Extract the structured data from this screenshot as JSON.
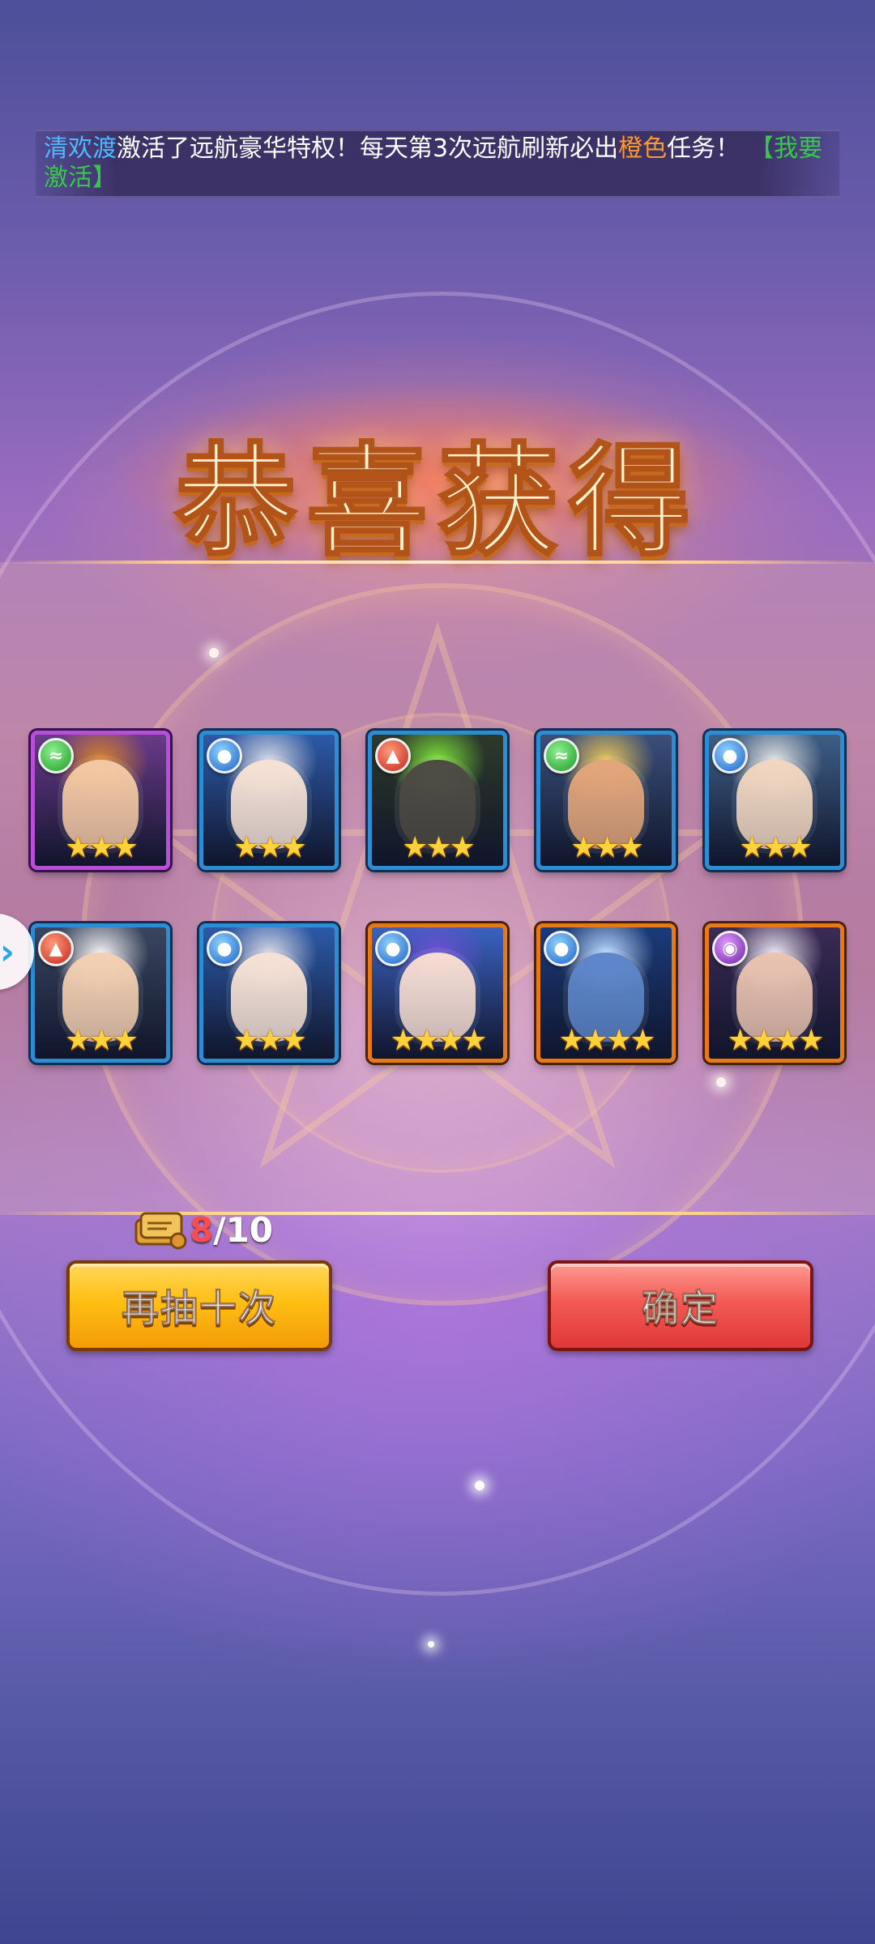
{
  "notice": {
    "player_name": "清欢渡",
    "text_1": "激活了远航豪华特权！每天第3次远航刷新必出",
    "highlight": "橙色",
    "text_2": "任务！",
    "link": "【我要激活】"
  },
  "title": "恭喜获得",
  "heroes": [
    {
      "element": "wind",
      "element_icon": "wind-element-icon",
      "frame": "purple",
      "stars": 3,
      "skin": "#f3c9a3",
      "hair": "#d9842e",
      "bg": "#6a3a8a"
    },
    {
      "element": "water",
      "element_icon": "water-element-icon",
      "frame": "blue",
      "stars": 3,
      "skin": "#f6e1d4",
      "hair": "#d6d8e6",
      "bg": "#2c5aa8"
    },
    {
      "element": "fire",
      "element_icon": "fire-element-icon",
      "frame": "blue",
      "stars": 3,
      "skin": "#4d4a44",
      "hair": "#7fe23a",
      "bg": "#2d3a2a"
    },
    {
      "element": "wind",
      "element_icon": "wind-element-icon",
      "frame": "blue",
      "stars": 3,
      "skin": "#e2a57a",
      "hair": "#e8c45a",
      "bg": "#3a4f7a"
    },
    {
      "element": "water",
      "element_icon": "water-element-icon",
      "frame": "blue",
      "stars": 3,
      "skin": "#f1d6c0",
      "hair": "#e2e2e2",
      "bg": "#3e5e86"
    },
    {
      "element": "fire",
      "element_icon": "fire-element-icon",
      "frame": "blue",
      "stars": 3,
      "skin": "#f3cfb1",
      "hair": "#f2f2f2",
      "bg": "#3a4660"
    },
    {
      "element": "water",
      "element_icon": "water-element-icon",
      "frame": "blue",
      "stars": 3,
      "skin": "#f6e1d4",
      "hair": "#d6d8e6",
      "bg": "#2c5aa8"
    },
    {
      "element": "water",
      "element_icon": "water-element-icon",
      "frame": "orange",
      "stars": 4,
      "skin": "#f6dcd0",
      "hair": "#6c4fd2",
      "bg": "#3a62c0"
    },
    {
      "element": "water",
      "element_icon": "water-element-icon",
      "frame": "orange",
      "stars": 4,
      "skin": "#5d86c9",
      "hair": "#b9d7ff",
      "bg": "#1b3b7a"
    },
    {
      "element": "dark",
      "element_icon": "dark-element-icon",
      "frame": "orange",
      "stars": 4,
      "skin": "#e9c2b0",
      "hair": "#e9e2f0",
      "bg": "#3b2a55"
    }
  ],
  "draw_count": {
    "current": "8",
    "separator": "/",
    "total": "10"
  },
  "buttons": {
    "draw_again": "再抽十次",
    "confirm": "确定"
  },
  "side_arrow": "›",
  "colors": {
    "accent_yellow": "#ffbf14",
    "accent_red": "#f35a55",
    "star": "#ffd23a"
  }
}
